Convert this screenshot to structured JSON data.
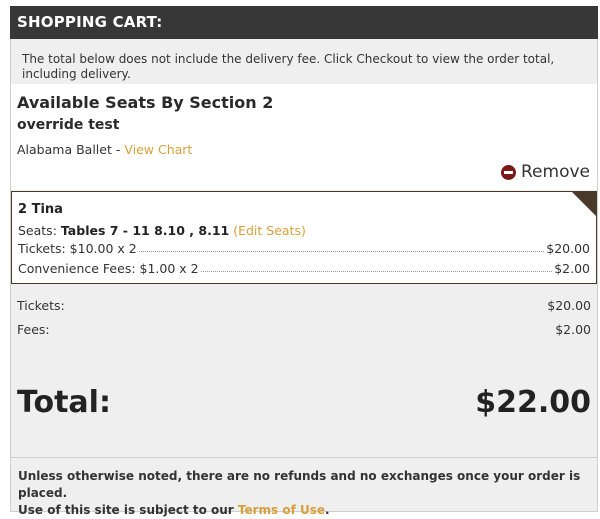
{
  "cart": {
    "title": "SHOPPING CART:",
    "notice": "The total below does not include the delivery fee. Click Checkout to view the order total, including delivery."
  },
  "event": {
    "title": "Available Seats By Section 2",
    "subtitle": "override test",
    "venue": "Alabama Ballet",
    "venue_sep": " - ",
    "view_chart_label": "View Chart",
    "remove_label": "Remove"
  },
  "item": {
    "name": "2 Tina",
    "seats_prefix": "Seats: ",
    "seats_value": "Tables 7 - 11 8.10 , 8.11",
    "edit_seats_label": "(Edit Seats)",
    "tickets_label": "Tickets: $10.00 x 2",
    "tickets_amount": "$20.00",
    "fees_label": "Convenience Fees: $1.00 x 2",
    "fees_amount": "$2.00"
  },
  "summary": {
    "tickets_label": "Tickets:",
    "tickets_amount": "$20.00",
    "fees_label": "Fees:",
    "fees_amount": "$2.00",
    "total_label": "Total:",
    "total_amount": "$22.00"
  },
  "policy": {
    "line1": "Unless otherwise noted, there are no refunds and no exchanges once your order is placed.",
    "line2_prefix": "Use of this site is subject to our ",
    "terms_label": "Terms of Use",
    "line2_suffix": "."
  },
  "colors": {
    "header_bg": "#373737",
    "link": "#d8a03a",
    "remove_icon": "#7a1a1a",
    "item_border": "#4a3a2a"
  }
}
